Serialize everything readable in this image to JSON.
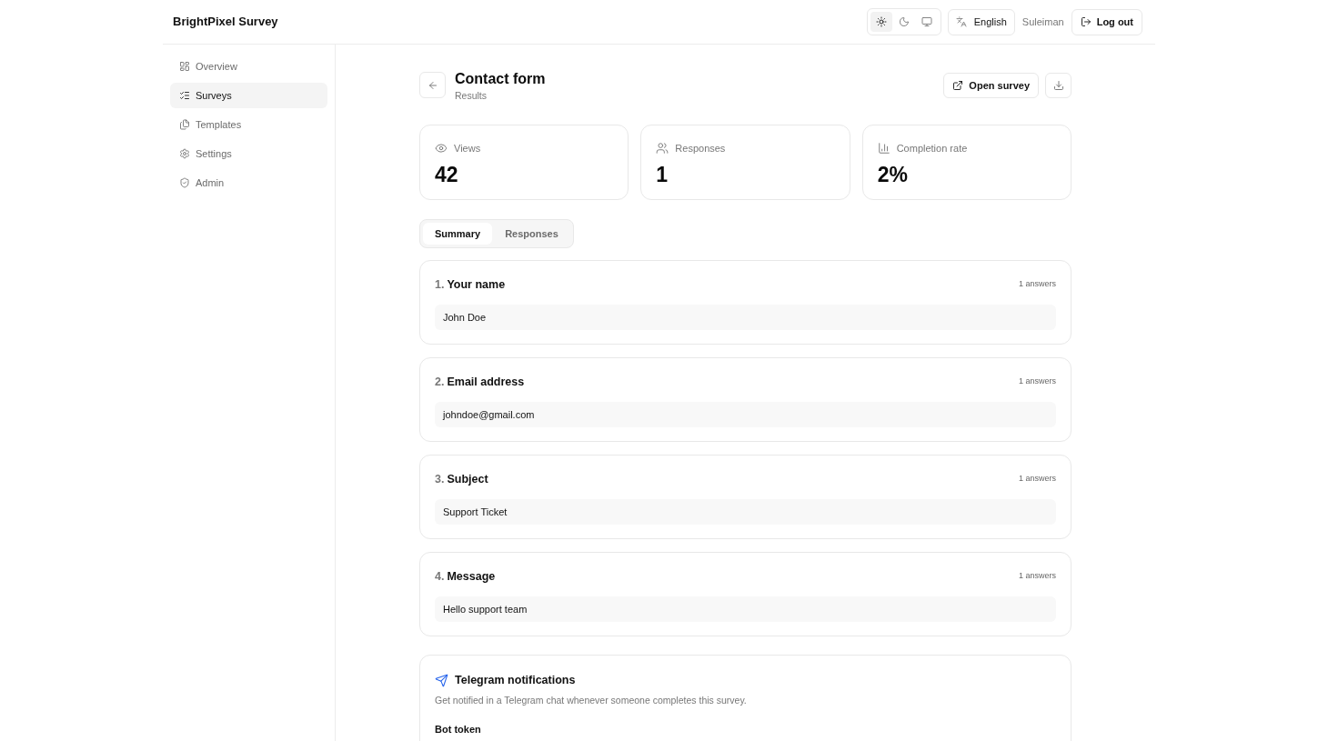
{
  "header": {
    "brand": "BrightPixel Survey",
    "theme_options": [
      {
        "selected": true
      },
      {
        "selected": false
      },
      {
        "selected": false
      }
    ],
    "language": "English",
    "user": "Suleiman",
    "logout": "Log out"
  },
  "sidebar": {
    "items": [
      {
        "label": "Overview",
        "selected": false
      },
      {
        "label": "Surveys",
        "selected": true
      },
      {
        "label": "Templates",
        "selected": false
      },
      {
        "label": "Settings",
        "selected": false
      },
      {
        "label": "Admin",
        "selected": false
      }
    ]
  },
  "page": {
    "title": "Contact form",
    "subtitle": "Results",
    "open_button": "Open survey"
  },
  "stats": [
    {
      "label": "Views",
      "value": "42"
    },
    {
      "label": "Responses",
      "value": "1"
    },
    {
      "label": "Completion rate",
      "value": "2%"
    }
  ],
  "tabs": [
    {
      "label": "Summary",
      "selected": true
    },
    {
      "label": "Responses",
      "selected": false
    }
  ],
  "questions": [
    {
      "number": "1.",
      "title": "Your name",
      "answer_count": "1 answers",
      "answers": [
        "John Doe"
      ]
    },
    {
      "number": "2.",
      "title": "Email address",
      "answer_count": "1 answers",
      "answers": [
        "johndoe@gmail.com"
      ]
    },
    {
      "number": "3.",
      "title": "Subject",
      "answer_count": "1 answers",
      "answers": [
        "Support Ticket"
      ]
    },
    {
      "number": "4.",
      "title": "Message",
      "answer_count": "1 answers",
      "answers": [
        "Hello support team"
      ]
    }
  ],
  "telegram": {
    "title": "Telegram notifications",
    "description": "Get notified in a Telegram chat whenever someone completes this survey.",
    "fields": [
      {
        "label": "Bot token"
      }
    ]
  }
}
